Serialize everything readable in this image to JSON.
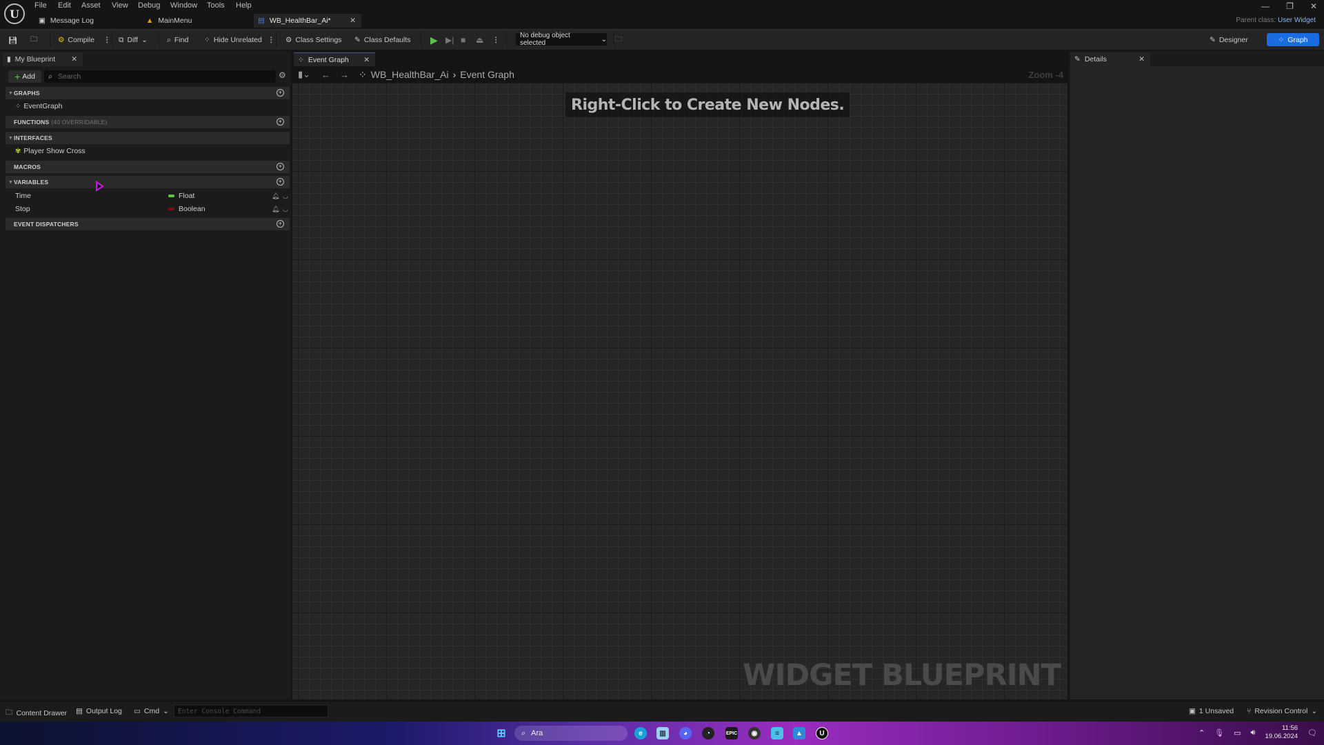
{
  "app": {
    "menu": [
      "File",
      "Edit",
      "Asset",
      "View",
      "Debug",
      "Window",
      "Tools",
      "Help"
    ],
    "doc_tabs": [
      {
        "label": "Message Log",
        "icon": "message-log-icon"
      },
      {
        "label": "MainMenu",
        "icon": "level-icon"
      },
      {
        "label": "WB_HealthBar_Ai*",
        "icon": "widget-blueprint-icon",
        "active": true
      }
    ],
    "parent_class_label": "Parent class:",
    "parent_class_value": "User Widget",
    "window_controls": {
      "minimize": "—",
      "restore": "❐",
      "close": "✕"
    }
  },
  "toolbar": {
    "compile": "Compile",
    "diff": "Diff",
    "find": "Find",
    "hide_unrelated": "Hide Unrelated",
    "class_settings": "Class Settings",
    "class_defaults": "Class Defaults",
    "debug_object": "No debug object selected",
    "designer": "Designer",
    "graph": "Graph",
    "accent_color": "#1a6ce0"
  },
  "my_blueprint": {
    "tab_label": "My Blueprint",
    "add_label": "Add",
    "search_placeholder": "Search",
    "sections": {
      "graphs": "GRAPHS",
      "functions": "FUNCTIONS",
      "functions_sub": "(40 OVERRIDABLE)",
      "interfaces": "INTERFACES",
      "macros": "MACROS",
      "variables": "VARIABLES",
      "event_dispatchers": "EVENT DISPATCHERS"
    },
    "graphs": [
      "EventGraph"
    ],
    "interfaces": [
      "Player Show Cross"
    ],
    "variables": [
      {
        "name": "Time",
        "type": "Float",
        "color": "#5ec93a"
      },
      {
        "name": "Stop",
        "type": "Boolean",
        "color": "#8c0a0a"
      }
    ]
  },
  "graph": {
    "tab_label": "Event Graph",
    "breadcrumb": [
      "WB_HealthBar_Ai",
      "Event Graph"
    ],
    "zoom": "Zoom -4",
    "hint": "Right-Click to Create New Nodes.",
    "watermark": "WIDGET BLUEPRINT"
  },
  "details": {
    "tab_label": "Details"
  },
  "statusbar": {
    "content_drawer": "Content Drawer",
    "output_log": "Output Log",
    "cmd": "Cmd",
    "console_placeholder": "Enter Console Command",
    "unsaved": "1 Unsaved",
    "revision_control": "Revision Control"
  },
  "taskbar": {
    "search_placeholder": "Ara",
    "time": "11:56",
    "date": "19.06.2024",
    "apps": [
      "edge",
      "task-manager",
      "discord",
      "github",
      "epic-games",
      "obs",
      "notepad",
      "photos",
      "unreal-engine"
    ]
  }
}
